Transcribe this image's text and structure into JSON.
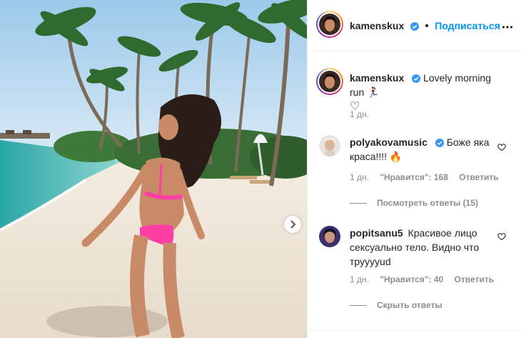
{
  "post": {
    "author": "kamenskux",
    "follow_label": "Подписаться",
    "separator": "•"
  },
  "caption": {
    "username": "kamenskux",
    "text": "Lovely morning run 🏃‍♀️",
    "extra": "♡",
    "time": "1 дн."
  },
  "comments": [
    {
      "username": "polyakovamusic",
      "verified": true,
      "text": "Боже яка краса!!!! 🔥",
      "time": "1 дн.",
      "likes": "\"Нравится\": 168",
      "reply_label": "Ответить",
      "replies_toggle": "Посмотреть ответы (15)"
    },
    {
      "username": "popitsanu5",
      "verified": false,
      "text": "Красивое лицо сексуально тело. Видно что трууууud",
      "time": "1 дн.",
      "likes": "\"Нравится\": 40",
      "reply_label": "Ответить",
      "replies_toggle": "Скрыть ответы"
    }
  ],
  "colors": {
    "accent": "#0095f6",
    "verified": "#3897f0",
    "bikini": "#ff3fa4"
  },
  "icons": {
    "verified": "verified-badge-icon",
    "more": "more-options-icon",
    "heart": "heart-outline-icon",
    "next": "chevron-right-icon"
  }
}
